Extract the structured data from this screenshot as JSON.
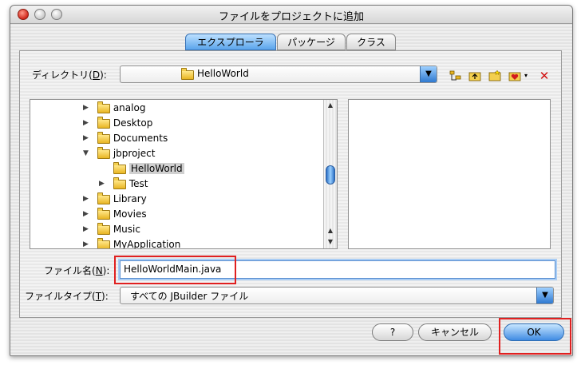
{
  "window": {
    "title": "ファイルをプロジェクトに追加"
  },
  "tabs": [
    {
      "label": "エクスプローラ",
      "active": true
    },
    {
      "label": "パッケージ",
      "active": false
    },
    {
      "label": "クラス",
      "active": false
    }
  ],
  "directory": {
    "label": "ディレクトリ(D):",
    "label_text": "ディレクトリ(",
    "mnemonic": "D",
    "label_tail": "):",
    "value": "HelloWorld"
  },
  "toolbar": {
    "icons": [
      "tree-view-icon",
      "up-folder-icon",
      "new-folder-icon",
      "favorites-icon",
      "dropdown-caret-icon",
      "delete-icon"
    ],
    "delete_glyph": "✕"
  },
  "tree": {
    "items": [
      {
        "label": "analog",
        "expander": "▶",
        "expanded": false,
        "selected": false
      },
      {
        "label": "Desktop",
        "expander": "▶",
        "expanded": false,
        "selected": false
      },
      {
        "label": "Documents",
        "expander": "▶",
        "expanded": false,
        "selected": false
      },
      {
        "label": "jbproject",
        "expander": "▼",
        "expanded": true,
        "selected": false
      },
      {
        "label": "HelloWorld",
        "expander": "",
        "expanded": false,
        "selected": true
      },
      {
        "label": "Test",
        "expander": "▶",
        "expanded": false,
        "selected": false
      },
      {
        "label": "Library",
        "expander": "▶",
        "expanded": false,
        "selected": false
      },
      {
        "label": "Movies",
        "expander": "▶",
        "expanded": false,
        "selected": false
      },
      {
        "label": "Music",
        "expander": "▶",
        "expanded": false,
        "selected": false
      },
      {
        "label": "MyApplication",
        "expander": "▶",
        "expanded": false,
        "selected": false
      }
    ]
  },
  "filename": {
    "label_text": "ファイル名(",
    "mnemonic": "N",
    "label_tail": "):",
    "value": "HelloWorldMain.java"
  },
  "filetype": {
    "label_text": "ファイルタイプ(",
    "mnemonic": "T",
    "label_tail": "):",
    "value": "すべての JBuilder ファイル"
  },
  "buttons": {
    "help": "?",
    "cancel": "キャンセル",
    "ok": "OK"
  },
  "colors": {
    "highlight": "#e02020",
    "accent": "#3f8be3"
  }
}
